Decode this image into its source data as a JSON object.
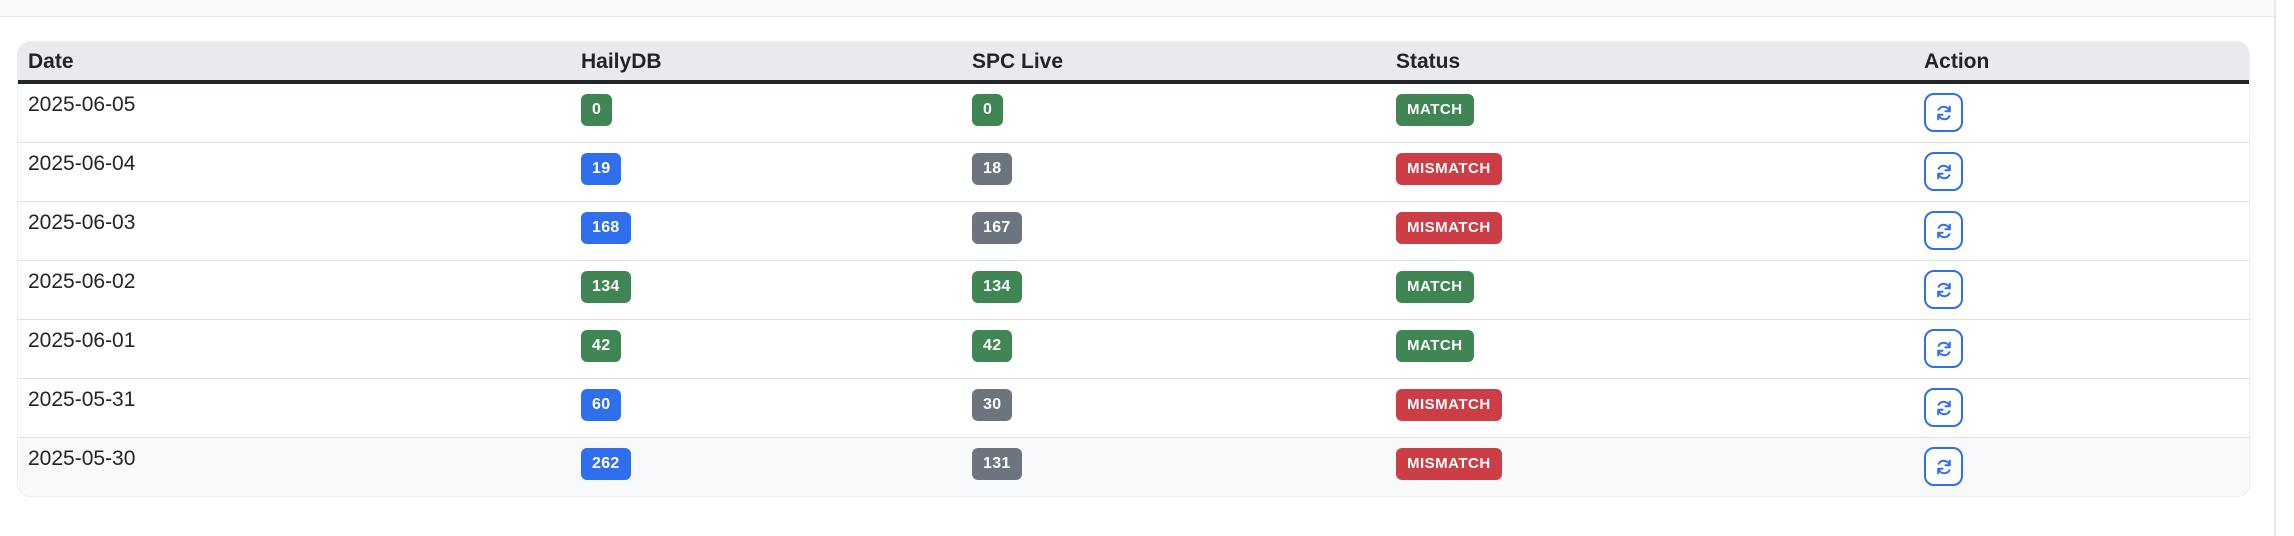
{
  "colors": {
    "match_green": "#3f8654",
    "mismatch_red": "#cc3d45",
    "count_blue": "#2f6fed",
    "count_gray": "#6c757d",
    "header_bg": "#e9eaee"
  },
  "table": {
    "headers": {
      "date": "Date",
      "hailydb": "HailyDB",
      "spc_live": "SPC Live",
      "status": "Status",
      "action": "Action"
    },
    "rows": [
      {
        "date": "2025-06-05",
        "hailydb": "0",
        "spc_live": "0",
        "status": "MATCH",
        "haily_color": "#3f8654",
        "spc_color": "#3f8654",
        "status_color": "#3f8654"
      },
      {
        "date": "2025-06-04",
        "hailydb": "19",
        "spc_live": "18",
        "status": "MISMATCH",
        "haily_color": "#2f6fed",
        "spc_color": "#6c757d",
        "status_color": "#cc3d45"
      },
      {
        "date": "2025-06-03",
        "hailydb": "168",
        "spc_live": "167",
        "status": "MISMATCH",
        "haily_color": "#2f6fed",
        "spc_color": "#6c757d",
        "status_color": "#cc3d45"
      },
      {
        "date": "2025-06-02",
        "hailydb": "134",
        "spc_live": "134",
        "status": "MATCH",
        "haily_color": "#3f8654",
        "spc_color": "#3f8654",
        "status_color": "#3f8654"
      },
      {
        "date": "2025-06-01",
        "hailydb": "42",
        "spc_live": "42",
        "status": "MATCH",
        "haily_color": "#3f8654",
        "spc_color": "#3f8654",
        "status_color": "#3f8654"
      },
      {
        "date": "2025-05-31",
        "hailydb": "60",
        "spc_live": "30",
        "status": "MISMATCH",
        "haily_color": "#2f6fed",
        "spc_color": "#6c757d",
        "status_color": "#cc3d45"
      },
      {
        "date": "2025-05-30",
        "hailydb": "262",
        "spc_live": "131",
        "status": "MISMATCH",
        "haily_color": "#2f6fed",
        "spc_color": "#6c757d",
        "status_color": "#cc3d45"
      }
    ],
    "action_icon": "refresh-icon"
  }
}
